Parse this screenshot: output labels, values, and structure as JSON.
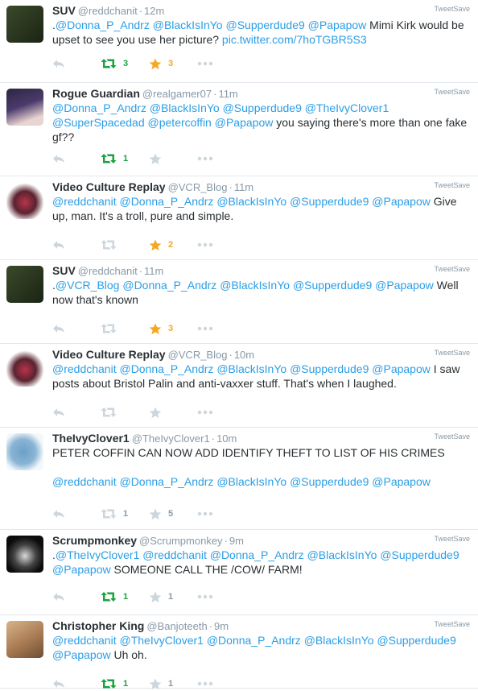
{
  "tweetsave_label": "TweetSave",
  "tweets": [
    {
      "name": "SUV",
      "handle": "@reddchanit",
      "time": "12m",
      "text_parts": [
        {
          "t": ".",
          "m": false
        },
        {
          "t": "@Donna_P_Andrz",
          "m": true
        },
        {
          "t": " ",
          "m": false
        },
        {
          "t": "@BlackIsInYo",
          "m": true
        },
        {
          "t": " ",
          "m": false
        },
        {
          "t": "@Supperdude9",
          "m": true
        },
        {
          "t": " ",
          "m": false
        },
        {
          "t": "@Papapow",
          "m": true
        },
        {
          "t": " Mimi Kirk would be upset to see you use her picture? ",
          "m": false
        },
        {
          "t": "pic.twitter.com/7hoTGBR5S3",
          "m": true
        }
      ],
      "retweets": "3",
      "favorites": "3",
      "rt_active": true,
      "fav_active": true
    },
    {
      "name": "Rogue Guardian",
      "handle": "@realgamer07",
      "time": "11m",
      "text_parts": [
        {
          "t": "@Donna_P_Andrz",
          "m": true
        },
        {
          "t": " ",
          "m": false
        },
        {
          "t": "@BlackIsInYo",
          "m": true
        },
        {
          "t": " ",
          "m": false
        },
        {
          "t": "@Supperdude9",
          "m": true
        },
        {
          "t": " ",
          "m": false
        },
        {
          "t": "@TheIvyClover1",
          "m": true
        },
        {
          "t": " ",
          "m": false
        },
        {
          "t": "@SuperSpacedad",
          "m": true
        },
        {
          "t": " ",
          "m": false
        },
        {
          "t": "@petercoffin",
          "m": true
        },
        {
          "t": " ",
          "m": false
        },
        {
          "t": "@Papapow",
          "m": true
        },
        {
          "t": " you saying there's more than one fake gf??",
          "m": false
        }
      ],
      "retweets": "1",
      "favorites": "",
      "rt_active": true,
      "fav_active": false
    },
    {
      "name": "Video Culture Replay",
      "handle": "@VCR_Blog",
      "time": "11m",
      "text_parts": [
        {
          "t": "@reddchanit",
          "m": true
        },
        {
          "t": " ",
          "m": false
        },
        {
          "t": "@Donna_P_Andrz",
          "m": true
        },
        {
          "t": " ",
          "m": false
        },
        {
          "t": "@BlackIsInYo",
          "m": true
        },
        {
          "t": " ",
          "m": false
        },
        {
          "t": "@Supperdude9",
          "m": true
        },
        {
          "t": " ",
          "m": false
        },
        {
          "t": "@Papapow",
          "m": true
        },
        {
          "t": " Give up, man. It's a troll, pure and simple.",
          "m": false
        }
      ],
      "retweets": "",
      "favorites": "2",
      "rt_active": false,
      "fav_active": true
    },
    {
      "name": "SUV",
      "handle": "@reddchanit",
      "time": "11m",
      "text_parts": [
        {
          "t": ".",
          "m": false
        },
        {
          "t": "@VCR_Blog",
          "m": true
        },
        {
          "t": " ",
          "m": false
        },
        {
          "t": "@Donna_P_Andrz",
          "m": true
        },
        {
          "t": " ",
          "m": false
        },
        {
          "t": "@BlackIsInYo",
          "m": true
        },
        {
          "t": " ",
          "m": false
        },
        {
          "t": "@Supperdude9",
          "m": true
        },
        {
          "t": " ",
          "m": false
        },
        {
          "t": "@Papapow",
          "m": true
        },
        {
          "t": " Well now that's known",
          "m": false
        }
      ],
      "retweets": "",
      "favorites": "3",
      "rt_active": false,
      "fav_active": true
    },
    {
      "name": "Video Culture Replay",
      "handle": "@VCR_Blog",
      "time": "10m",
      "text_parts": [
        {
          "t": "@reddchanit",
          "m": true
        },
        {
          "t": " ",
          "m": false
        },
        {
          "t": "@Donna_P_Andrz",
          "m": true
        },
        {
          "t": " ",
          "m": false
        },
        {
          "t": "@BlackIsInYo",
          "m": true
        },
        {
          "t": " ",
          "m": false
        },
        {
          "t": "@Supperdude9",
          "m": true
        },
        {
          "t": " ",
          "m": false
        },
        {
          "t": "@Papapow",
          "m": true
        },
        {
          "t": " I saw posts about Bristol Palin and anti-vaxxer stuff. That's when I laughed.",
          "m": false
        }
      ],
      "retweets": "",
      "favorites": "",
      "rt_active": false,
      "fav_active": false
    },
    {
      "name": "TheIvyClover1",
      "handle": "@TheIvyClover1",
      "time": "10m",
      "text_parts": [
        {
          "t": "PETER COFFIN CAN NOW ADD IDENTIFY THEFT TO LIST OF HIS CRIMES",
          "m": false
        },
        {
          "t": "\n\n",
          "m": false
        },
        {
          "t": "@reddchanit",
          "m": true
        },
        {
          "t": " ",
          "m": false
        },
        {
          "t": "@Donna_P_Andrz",
          "m": true
        },
        {
          "t": " ",
          "m": false
        },
        {
          "t": "@BlackIsInYo",
          "m": true
        },
        {
          "t": " ",
          "m": false
        },
        {
          "t": "@Supperdude9",
          "m": true
        },
        {
          "t": " ",
          "m": false
        },
        {
          "t": "@Papapow",
          "m": true
        }
      ],
      "retweets": "1",
      "favorites": "5",
      "rt_active": false,
      "fav_active": false
    },
    {
      "name": "Scrumpmonkey",
      "handle": "@Scrumpmonkey",
      "time": "9m",
      "text_parts": [
        {
          "t": ".",
          "m": false
        },
        {
          "t": "@TheIvyClover1",
          "m": true
        },
        {
          "t": " ",
          "m": false
        },
        {
          "t": "@reddchanit",
          "m": true
        },
        {
          "t": " ",
          "m": false
        },
        {
          "t": "@Donna_P_Andrz",
          "m": true
        },
        {
          "t": " ",
          "m": false
        },
        {
          "t": "@BlackIsInYo",
          "m": true
        },
        {
          "t": " ",
          "m": false
        },
        {
          "t": "@Supperdude9",
          "m": true
        },
        {
          "t": " ",
          "m": false
        },
        {
          "t": "@Papapow",
          "m": true
        },
        {
          "t": " SOMEONE CALL THE /COW/ FARM!",
          "m": false
        }
      ],
      "retweets": "1",
      "favorites": "1",
      "rt_active": true,
      "fav_active": false
    },
    {
      "name": "Christopher King",
      "handle": "@Banjoteeth",
      "time": "9m",
      "text_parts": [
        {
          "t": "@reddchanit",
          "m": true
        },
        {
          "t": " ",
          "m": false
        },
        {
          "t": "@TheIvyClover1",
          "m": true
        },
        {
          "t": " ",
          "m": false
        },
        {
          "t": "@Donna_P_Andrz",
          "m": true
        },
        {
          "t": " ",
          "m": false
        },
        {
          "t": "@BlackIsInYo",
          "m": true
        },
        {
          "t": " ",
          "m": false
        },
        {
          "t": "@Supperdude9",
          "m": true
        },
        {
          "t": " ",
          "m": false
        },
        {
          "t": "@Papapow",
          "m": true
        },
        {
          "t": " Uh oh.",
          "m": false
        }
      ],
      "retweets": "1",
      "favorites": "1",
      "rt_active": true,
      "fav_active": false
    }
  ],
  "colors": {
    "mention": "#2b9ee6",
    "retweet_active": "#19a340",
    "favorite_active": "#f5a623",
    "muted": "#8899a6"
  }
}
